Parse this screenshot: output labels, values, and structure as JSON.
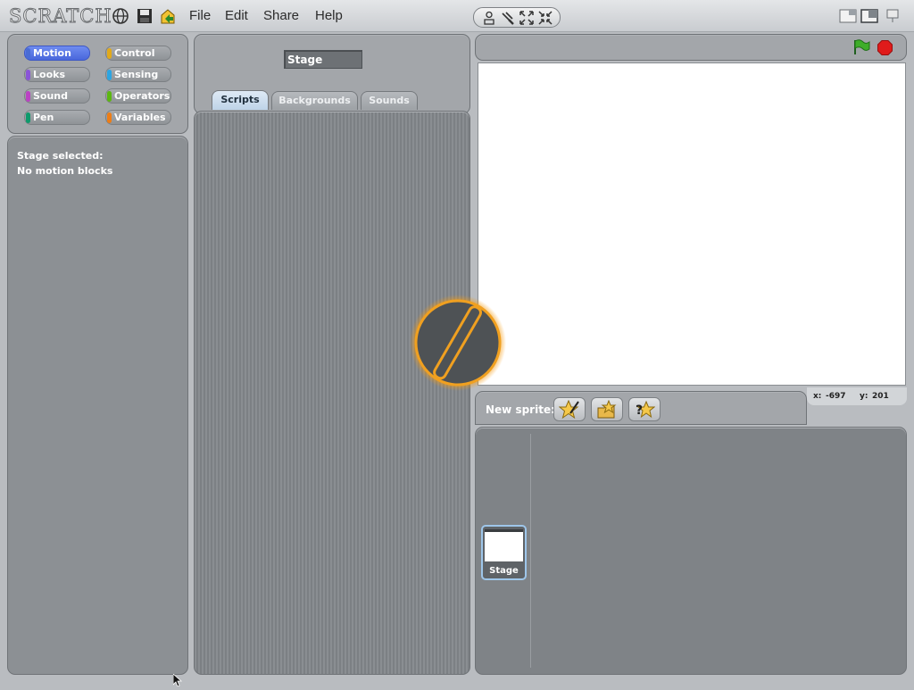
{
  "app": {
    "logo_text": "SCRATCH"
  },
  "menu": {
    "file": "File",
    "edit": "Edit",
    "share": "Share",
    "help": "Help"
  },
  "top_icons": [
    "globe-icon",
    "save-icon",
    "share-icon"
  ],
  "tools": [
    "duplicate-icon",
    "delete-icon",
    "grow-icon",
    "shrink-icon"
  ],
  "view_modes": [
    "small-stage-mode-icon",
    "normal-mode-icon",
    "presentation-mode-icon"
  ],
  "categories": {
    "motion": {
      "label": "Motion",
      "color": "#4a6cd4"
    },
    "control": {
      "label": "Control",
      "color": "#e1a91a"
    },
    "looks": {
      "label": "Looks",
      "color": "#8a55d7"
    },
    "sensing": {
      "label": "Sensing",
      "color": "#2ca5e2"
    },
    "sound": {
      "label": "Sound",
      "color": "#bb42c3"
    },
    "operators": {
      "label": "Operators",
      "color": "#5cb712"
    },
    "pen": {
      "label": "Pen",
      "color": "#0e9a6c"
    },
    "variables": {
      "label": "Variables",
      "color": "#ee7d16"
    },
    "selected": "Motion"
  },
  "palette": {
    "line1": "Stage selected:",
    "line2": "No motion blocks"
  },
  "sprite_name_value": "Stage",
  "tabs": {
    "scripts": "Scripts",
    "backgrounds": "Backgrounds",
    "sounds": "Sounds",
    "active": "Scripts"
  },
  "stage_controls": {
    "flag": "green-flag-icon",
    "stop": "stop-sign-icon"
  },
  "coords": {
    "x_label": "x:",
    "x_value": "-697",
    "y_label": "y:",
    "y_value": "201"
  },
  "new_sprite": {
    "label": "New sprite:"
  },
  "sprite_list": {
    "stage_label": "Stage"
  },
  "overlay": {
    "icon": "busy-indicator-icon",
    "accent": "#f59a10"
  }
}
